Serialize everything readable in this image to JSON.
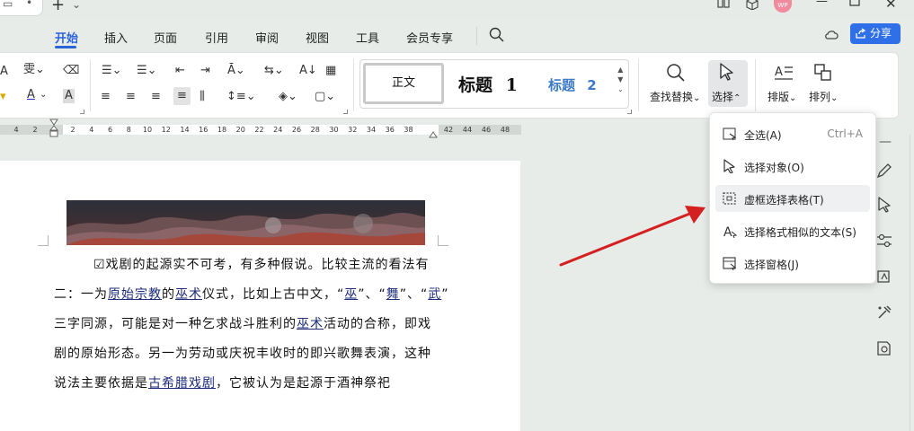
{
  "menu": {
    "tabs": [
      "开始",
      "插入",
      "页面",
      "引用",
      "审阅",
      "视图",
      "工具",
      "会员专享"
    ],
    "active_tab": "开始",
    "share_label": "分享"
  },
  "ribbon": {
    "styles": {
      "normal": "正文",
      "heading1": "标题",
      "heading1_num": "1",
      "heading2": "标题",
      "heading2_num": "2"
    },
    "find_replace": "查找替换",
    "select": "选择",
    "layout": "排版",
    "arrange": "排列"
  },
  "ruler": {
    "left_numbers": [
      "4",
      "2"
    ],
    "numbers": [
      "2",
      "4",
      "6",
      "8",
      "10",
      "12",
      "14",
      "16",
      "18",
      "20",
      "22",
      "24",
      "26",
      "28",
      "30",
      "32",
      "34",
      "36",
      "38"
    ],
    "right_numbers": [
      "42",
      "44",
      "46",
      "48"
    ]
  },
  "document": {
    "lines": [
      [
        {
          "t": "☑戏剧的起源实不可考，有多种假说。比较主流的看法有"
        }
      ],
      [
        {
          "t": "二：一为"
        },
        {
          "t": "原始宗教",
          "u": true
        },
        {
          "t": "的"
        },
        {
          "t": "巫术",
          "u": true
        },
        {
          "t": "仪式，比如上古中文，“"
        },
        {
          "t": "巫",
          "u": true
        },
        {
          "t": "”、“"
        },
        {
          "t": "舞",
          "u": true
        },
        {
          "t": "”、“"
        },
        {
          "t": "武",
          "u": true
        },
        {
          "t": "”"
        }
      ],
      [
        {
          "t": "三字同源，可能是对一种乞求战斗胜利的"
        },
        {
          "t": "巫术",
          "u": true
        },
        {
          "t": "活动的合称，即戏"
        }
      ],
      [
        {
          "t": "剧的原始形态。另一为劳动或庆祝丰收时的即兴歌舞表演，这种"
        }
      ],
      [
        {
          "t": "说法主要依据是"
        },
        {
          "t": "古希腊戏剧",
          "u": true
        },
        {
          "t": "，它被认为是起源于酒神祭祀"
        }
      ]
    ]
  },
  "dropdown": {
    "items": [
      {
        "label": "全选(A)",
        "shortcut": "Ctrl+A",
        "icon": "select-all-icon"
      },
      {
        "label": "选择对象(O)",
        "shortcut": "",
        "icon": "cursor-arrow-icon"
      },
      {
        "label": "虚框选择表格(T)",
        "shortcut": "",
        "icon": "dashed-frame-icon"
      },
      {
        "label": "选择格式相似的文本(S)",
        "shortcut": "",
        "icon": "similar-text-icon"
      },
      {
        "label": "选择窗格(J)",
        "shortcut": "",
        "icon": "selection-pane-icon"
      }
    ],
    "hovered_index": 2
  },
  "avatar_text": "WP",
  "colors": {
    "accent": "#2a62d8",
    "share_bg": "#2f6fe8",
    "arrow": "#d42020",
    "link_underline": "#1f2c7a"
  }
}
